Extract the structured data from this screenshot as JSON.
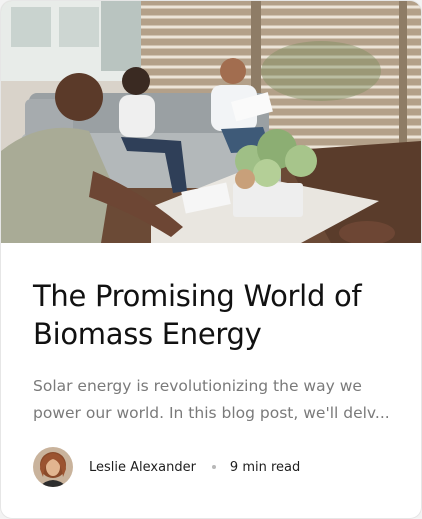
{
  "post": {
    "title": "The Promising World of Biomass Energy",
    "excerpt": "Solar energy is revolutionizing the way we power our world. In this blog post, we'll delv...",
    "author": "Leslie Alexander",
    "read_time": "9 min read"
  },
  "icons": {
    "cover": "office-lounge-photo",
    "avatar": "author-avatar-photo"
  },
  "colors": {
    "title": "#111111",
    "excerpt": "#7a7a7a",
    "meta": "#1e1e1e",
    "separator": "#b8b8b8"
  }
}
